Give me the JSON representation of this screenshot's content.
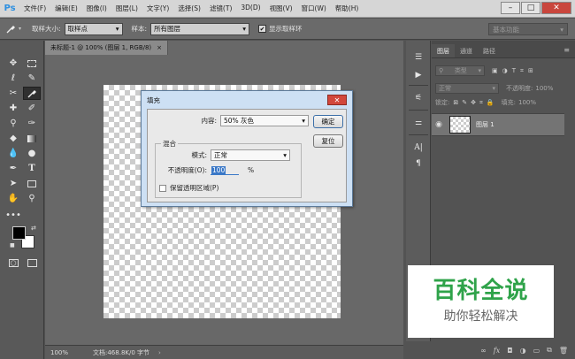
{
  "app": {
    "logo": "Ps"
  },
  "menu": {
    "items": [
      "文件(F)",
      "编辑(E)",
      "图像(I)",
      "图层(L)",
      "文字(Y)",
      "选择(S)",
      "滤镜(T)",
      "3D(D)",
      "视图(V)",
      "窗口(W)",
      "帮助(H)"
    ]
  },
  "window_controls": {
    "minimize": "–",
    "maximize": "□",
    "close": "✕"
  },
  "options": {
    "sample_size_label": "取样大小:",
    "sample_size_value": "取样点",
    "sample_label": "样本:",
    "sample_value": "所有图层",
    "show_ring_label": "显示取样环",
    "show_ring_checked": true,
    "workspace_value": "基本功能"
  },
  "document": {
    "tab_title": "未标题-1 @ 100% (图层 1, RGB/8)",
    "tab_close": "×",
    "status_zoom": "100%",
    "status_doc": "文档:468.8K/0 字节"
  },
  "dialog": {
    "title": "填充",
    "close": "✕",
    "content_label": "内容:",
    "content_value": "50% 灰色",
    "ok": "确定",
    "reset": "复位",
    "blend_group_label": "混合",
    "mode_label": "模式:",
    "mode_value": "正常",
    "opacity_label": "不透明度(O):",
    "opacity_value": "100",
    "opacity_unit": "%",
    "preserve_label": "保留透明区域(P)",
    "preserve_checked": false
  },
  "layers_panel": {
    "tabs": [
      "图层",
      "通道",
      "路径"
    ],
    "active_tab": 0,
    "filter_label": "类型",
    "blend_mode": "正常",
    "opacity_label": "不透明度:",
    "opacity_value": "100%",
    "lock_label": "锁定:",
    "fill_label": "填充:",
    "fill_value": "100%",
    "layer_name": "图层 1"
  },
  "watermark": {
    "title": "百科全说",
    "subtitle": "助你轻松解决"
  },
  "colors": {
    "accent": "#2fa34a",
    "dialog_frame": "#cde0f4",
    "ps_blue": "#2d8fe0"
  }
}
